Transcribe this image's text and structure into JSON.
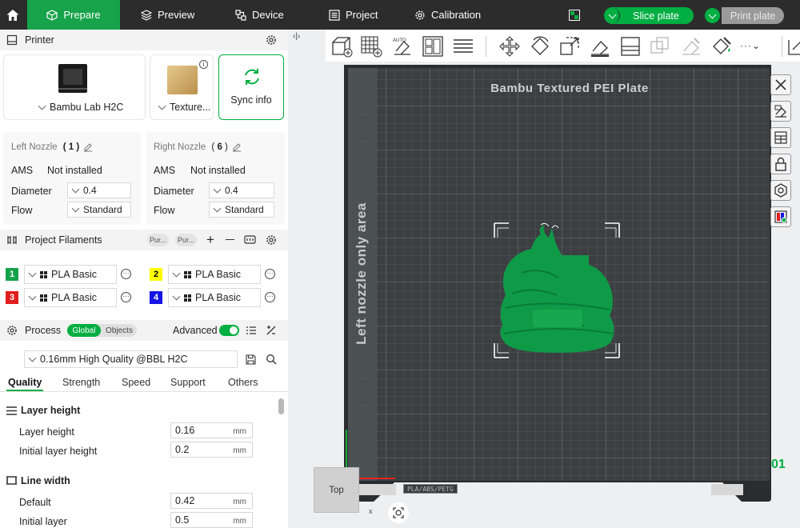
{
  "topbar": {
    "tabs": [
      {
        "label": "Prepare",
        "active": true
      },
      {
        "label": "Preview"
      },
      {
        "label": "Device"
      },
      {
        "label": "Project"
      },
      {
        "label": "Calibration"
      }
    ],
    "slice_label": "Slice plate",
    "print_label": "Print plate"
  },
  "printer": {
    "section_title": "Printer",
    "model_name": "Bambu Lab H2C",
    "plate_name": "Texture...",
    "sync_label": "Sync info",
    "left_nozzle": {
      "title": "Left Nozzle",
      "index": "( 1 )",
      "ams_label": "AMS",
      "ams_value": "Not installed",
      "diameter_label": "Diameter",
      "diameter_value": "0.4",
      "flow_label": "Flow",
      "flow_value": "Standard"
    },
    "right_nozzle": {
      "title": "Right Nozzle",
      "index_open": "( ",
      "index_num": "6",
      "index_close": " )",
      "ams_label": "AMS",
      "ams_value": "Not installed",
      "diameter_label": "Diameter",
      "diameter_value": "0.4",
      "flow_label": "Flow",
      "flow_value": "Standard"
    }
  },
  "filaments": {
    "section_title": "Project Filaments",
    "pill1": "Pur...",
    "pill2": "Pur...",
    "items": [
      {
        "num": "1",
        "name": "PLA Basic",
        "bg": "#16a34a",
        "fg": "#ffffff"
      },
      {
        "num": "2",
        "name": "PLA Basic",
        "bg": "#ffff00",
        "fg": "#000000"
      },
      {
        "num": "3",
        "name": "PLA Basic",
        "bg": "#e11d1d",
        "fg": "#ffffff"
      },
      {
        "num": "4",
        "name": "PLA Basic",
        "bg": "#1414e6",
        "fg": "#ffffff"
      }
    ]
  },
  "process": {
    "section_title": "Process",
    "global_label": "Global",
    "objects_label": "Objects",
    "advanced_label": "Advanced",
    "preset": "0.16mm High Quality @BBL H2C",
    "tabs": [
      "Quality",
      "Strength",
      "Speed",
      "Support",
      "Others"
    ],
    "groups": [
      {
        "title": "Layer height",
        "params": [
          {
            "label": "Layer height",
            "value": "0.16",
            "unit": "mm"
          },
          {
            "label": "Initial layer height",
            "value": "0.2",
            "unit": "mm"
          }
        ]
      },
      {
        "title": "Line width",
        "params": [
          {
            "label": "Default",
            "value": "0.42",
            "unit": "mm"
          },
          {
            "label": "Initial layer",
            "value": "0.5",
            "unit": "mm"
          }
        ]
      }
    ]
  },
  "viewport": {
    "plate_title": "Bambu Textured PEI Plate",
    "side_label": "Left nozzle only area",
    "plate_number": "01",
    "plate_tag": "PLA/ABS/PETG",
    "view_cube_label": "Top",
    "axis_label": "x"
  },
  "colors": {
    "accent": "#00ae42",
    "topbar": "#2c2c2c",
    "bed": "#3b3f41",
    "model": "#0f9a47"
  }
}
